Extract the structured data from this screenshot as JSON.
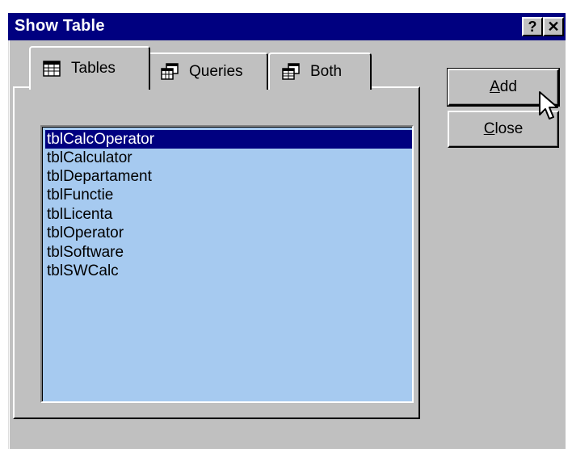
{
  "window": {
    "title": "Show Table",
    "help_label": "?",
    "close_label": "✕"
  },
  "tabs": [
    {
      "label": "Tables",
      "icon": "table-icon",
      "selected": true
    },
    {
      "label": "Queries",
      "icon": "query-icon",
      "selected": false
    },
    {
      "label": "Both",
      "icon": "both-icon",
      "selected": false
    }
  ],
  "table_list": {
    "items": [
      "tblCalcOperator",
      "tblCalculator",
      "tblDepartament",
      "tblFunctie",
      "tblLicenta",
      "tblOperator",
      "tblSoftware",
      "tblSWCalc"
    ],
    "selected_index": 0
  },
  "buttons": {
    "add": {
      "accel": "A",
      "rest": "dd"
    },
    "close": {
      "accel": "C",
      "rest": "lose"
    }
  },
  "colors": {
    "titlebar": "#000080",
    "dialog_face": "#c0c0c0",
    "list_background": "#a6caf0",
    "selection": "#000080"
  }
}
